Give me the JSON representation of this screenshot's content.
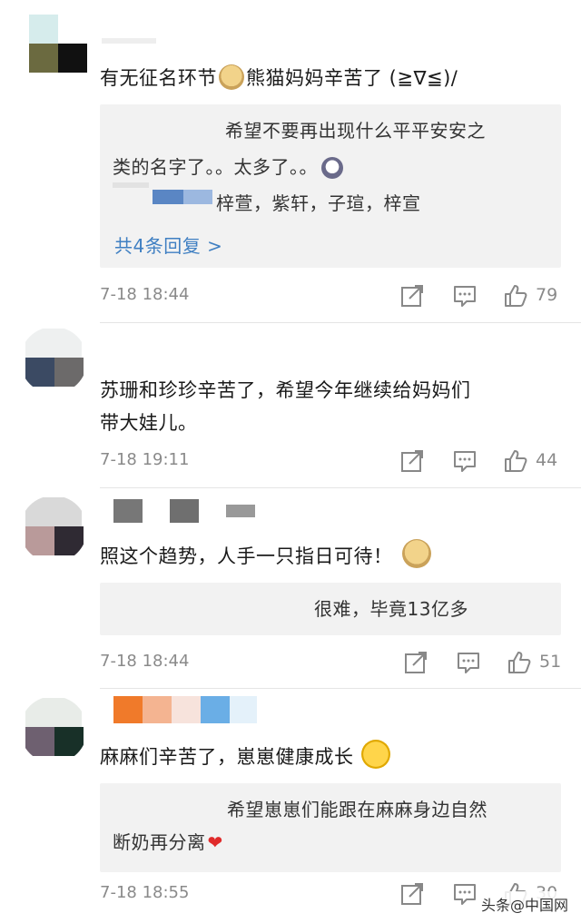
{
  "comments": [
    {
      "text": "有无征名环节",
      "text_after": "熊猫妈妈辛苦了 (≧∇≦)/",
      "reply_box": {
        "lines": [
          "希望不要再出现什么平平安安之",
          "类的名字了。。太多了。。"
        ],
        "sub_reply": "梓萱，紫轩，子瑄，梓宣",
        "more_replies": "共4条回复 >"
      },
      "time": "7-18 18:44",
      "likes": "79"
    },
    {
      "text_lines": [
        "苏珊和珍珍辛苦了，希望今年继续给妈妈们",
        "带大娃儿。"
      ],
      "time": "7-18 19:11",
      "likes": "44"
    },
    {
      "text": "照这个趋势，人手一只指日可待！",
      "reply_box": {
        "line": "很难，毕竟13亿多"
      },
      "time": "7-18 18:44",
      "likes": "51"
    },
    {
      "text": "麻麻们辛苦了，崽崽健康成长",
      "reply_box": {
        "lines": [
          "希望崽崽们能跟在麻麻身边自然",
          "断奶再分离"
        ]
      },
      "time": "7-18 18:55",
      "likes": "30"
    }
  ],
  "watermark": "头条@中国网",
  "colors": {
    "link": "#3f7fc2",
    "meta": "#8a8a8a",
    "reply_bg": "#f2f2f2"
  },
  "icons": {
    "share": "share-icon",
    "comment": "comment-icon",
    "like": "thumbs-up-icon"
  }
}
